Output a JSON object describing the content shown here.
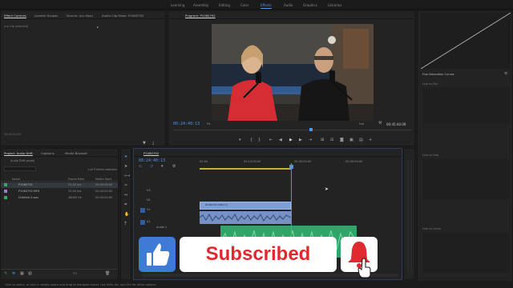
{
  "workspaces": [
    "Learning",
    "Assembly",
    "Editing",
    "Color",
    "Effects",
    "Audio",
    "Graphics",
    "Libraries"
  ],
  "active_workspace": "Effects",
  "source_panel": {
    "tabs": [
      "Effect Controls",
      "Lumetri Scopes",
      "Source: (no clips)",
      "Audio Clip Mixer: P1060792"
    ],
    "message": "(no clip selected)",
    "timecode": "00:00:00:00"
  },
  "program": {
    "tab": "Program: P1060792",
    "timecode": "00:24:40:13",
    "fit": "Fit",
    "quality": "Full",
    "duration": "00:45:44:09"
  },
  "project": {
    "tabs": [
      "Project: Audio Drift",
      "Captions",
      "Media Browser"
    ],
    "file": "Audio Drift.prproj",
    "items_selected": "1 of 3 items selected",
    "columns": [
      "Name",
      "Frame Rate",
      "Media Start"
    ],
    "rows": [
      {
        "name": "P1060792",
        "rate": "25.00 fps",
        "start": "00:00:00:00",
        "color": "#37a862"
      },
      {
        "name": "P1060792.MP4",
        "rate": "25.00 fps",
        "start": "00:00:00:00",
        "color": "#9a7cd6"
      },
      {
        "name": "Untitled 2.wav",
        "rate": "48000 Hz",
        "start": "00:00:00:00",
        "color": "#37a862"
      }
    ]
  },
  "timeline": {
    "tab": "P1060792",
    "timecode": "00:24:40:13",
    "ruler": [
      "00:00",
      "00:15:00:00",
      "00:30:00:00",
      "00:45:00:00"
    ],
    "video_clip": "P1060792.MP4 [V]",
    "tracks": [
      "V3",
      "V2",
      "V1",
      "A1",
      "A2",
      "A3"
    ],
    "audio_label": "Audio 1"
  },
  "right_panel": {
    "title": "Hue Saturation Curves",
    "curves": [
      "Hue vs Sat",
      "Hue vs Hue",
      "Hue vs Luma",
      "Luma vs Sat"
    ]
  },
  "status": "Click to select, or click in empty space and drag to marquee select. Use Shift, Alt, and Ctrl for other options.",
  "overlay": {
    "label": "Subscribed"
  }
}
